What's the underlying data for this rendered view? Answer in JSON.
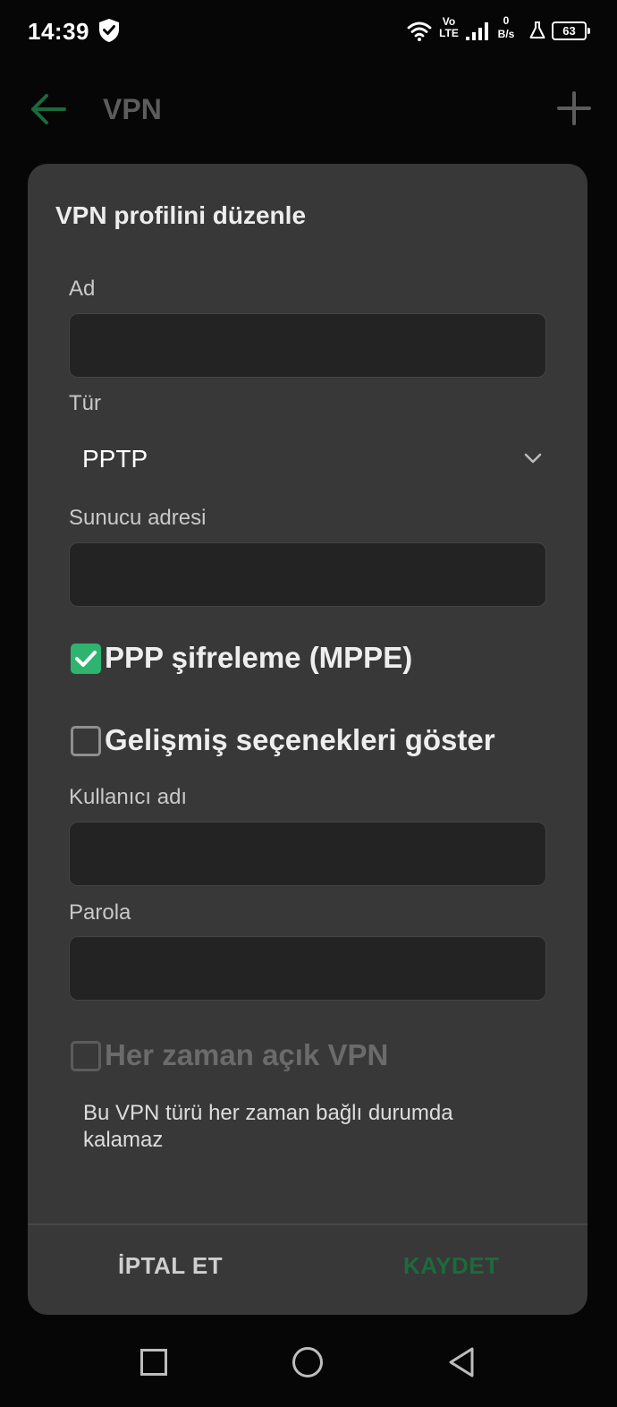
{
  "status_bar": {
    "time": "14:39",
    "network_type_top": "Vo",
    "network_type_bottom": "LTE",
    "speed_value": "0",
    "speed_unit": "B/s",
    "battery_level": "63"
  },
  "app_bar": {
    "title": "VPN"
  },
  "dialog": {
    "title": "VPN profilini düzenle",
    "name_label": "Ad",
    "name_value": "",
    "type_label": "Tür",
    "type_value": "PPTP",
    "server_label": "Sunucu adresi",
    "server_value": "",
    "ppp_encryption": {
      "label": "PPP şifreleme (MPPE)",
      "checked": true
    },
    "advanced_options": {
      "label": "Gelişmiş seçenekleri göster",
      "checked": false
    },
    "username_label": "Kullanıcı adı",
    "username_value": "",
    "password_label": "Parola",
    "password_value": "",
    "always_on": {
      "label": "Her zaman açık VPN",
      "checked": false,
      "enabled": false
    },
    "always_on_note": "Bu VPN türü her zaman bağlı durumda kalamaz",
    "cancel_label": "İPTAL ET",
    "save_label": "KAYDET"
  },
  "colors": {
    "accent": "#2db46e",
    "save_disabled": "#1d6a3c",
    "dialog_bg": "#383838",
    "input_bg": "#232323"
  },
  "icons": [
    "shield-icon",
    "wifi-icon",
    "signal-icon",
    "flask-icon",
    "battery-icon",
    "back-arrow-icon",
    "plus-icon",
    "chevron-down-icon",
    "check-icon",
    "nav-recents-icon",
    "nav-home-icon",
    "nav-back-icon"
  ]
}
